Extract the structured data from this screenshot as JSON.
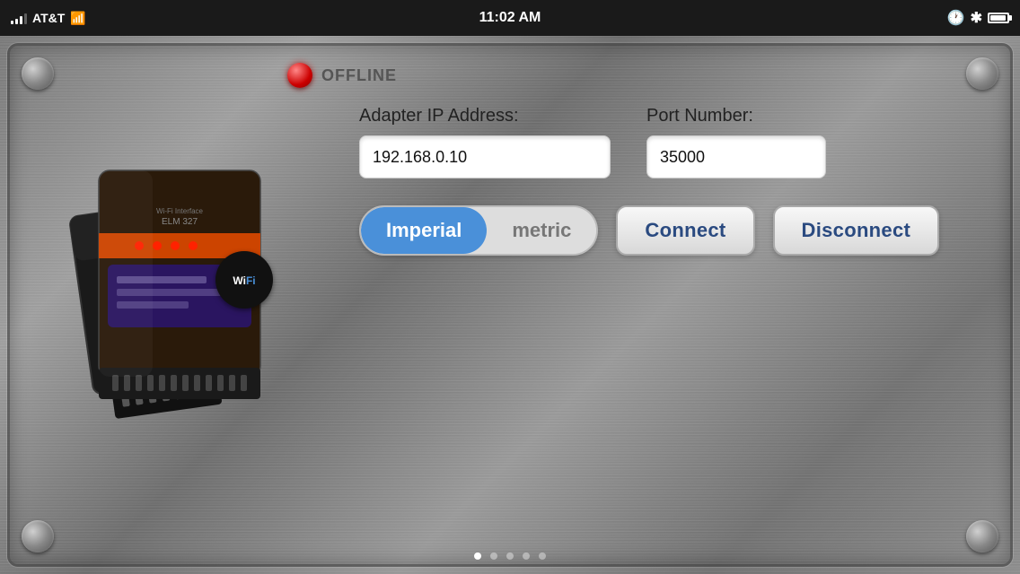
{
  "statusBar": {
    "carrier": "AT&T",
    "time": "11:02 AM",
    "icons": {
      "clock": "⏱",
      "bluetooth": "✱"
    }
  },
  "connection": {
    "status": "OFFLINE",
    "adapterLabel": "Adapter IP Address:",
    "ipValue": "192.168.0.10",
    "portLabel": "Port Number:",
    "portValue": "35000"
  },
  "units": {
    "imperial": "Imperial",
    "metric": "metric",
    "selected": "imperial"
  },
  "buttons": {
    "connect": "Connect",
    "disconnect": "Disconnect"
  },
  "pageDots": [
    true,
    false,
    false,
    false,
    false
  ],
  "wifiBadge": {
    "line1": "Wi",
    "line2": "Fi"
  }
}
